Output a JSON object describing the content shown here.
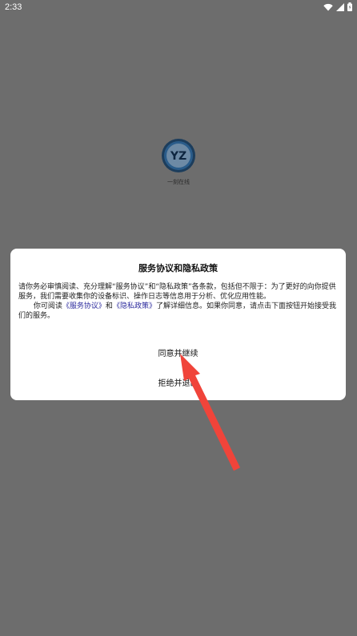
{
  "status_bar": {
    "time": "2:33",
    "icons": [
      "wifi-icon",
      "signal-icon",
      "battery-icon"
    ]
  },
  "splash": {
    "logo_text": "YZ",
    "logo_caption": "一刻在线"
  },
  "dialog": {
    "title": "服务协议和隐私政策",
    "paragraph1": "请你务必审慎阅读、充分理解“服务协议”和“隐私政策”各条款，包括但不限于：为了更好的向你提供服务，我们需要收集你的设备标识、操作日志等信息用于分析、优化应用性能。",
    "paragraph2_prefix": "你可阅读",
    "service_agreement_link": "《服务协议》",
    "and_text": "和",
    "privacy_policy_link": "《隐私政策》",
    "paragraph2_suffix": "了解详细信息。如果你同意，请点击下面按钮开始接受我们的服务。",
    "agree_button": "同意并继续",
    "decline_button": "拒绝并退出"
  },
  "colors": {
    "overlay": "#6d6d6d",
    "link": "#2d2c9e",
    "arrow": "#f0443a",
    "logo_ring": "#2a5c8a"
  }
}
